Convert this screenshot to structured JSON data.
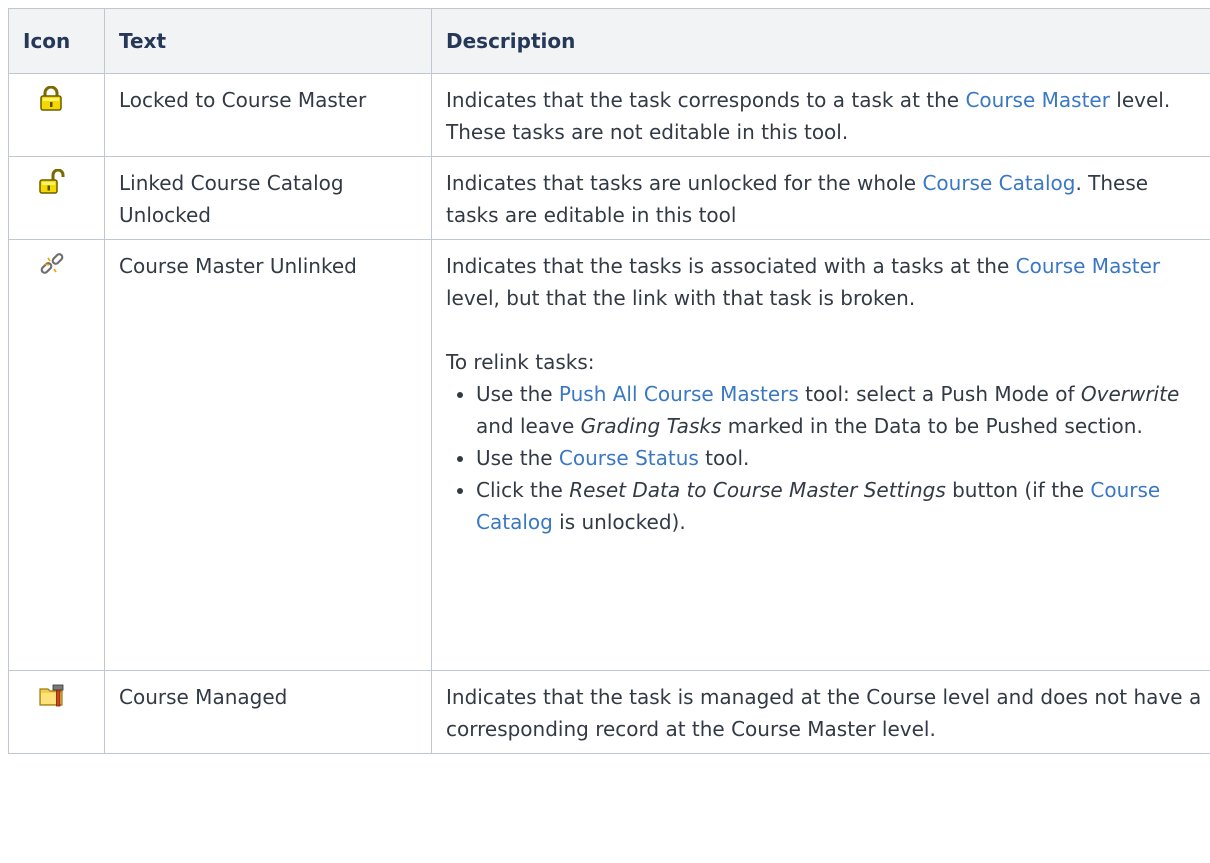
{
  "table": {
    "headers": {
      "icon": "Icon",
      "text": "Text",
      "description": "Description"
    },
    "rows": [
      {
        "icon": "padlock-locked-icon",
        "text": "Locked to Course Master",
        "desc": {
          "p1a": "Indicates that the task corresponds to a task at the ",
          "link1": "Course Master",
          "p1b": " level. These tasks are not editable in this tool."
        }
      },
      {
        "icon": "padlock-unlocked-icon",
        "text": "Linked Course Catalog Unlocked",
        "desc": {
          "p1a": "Indicates that tasks are unlocked for the whole ",
          "link1": "Course Catalog",
          "p1b": ". These tasks are editable in this tool"
        }
      },
      {
        "icon": "broken-link-icon",
        "text": "Course Master Unlinked",
        "desc": {
          "p1a": "Indicates that the tasks is associated with a tasks at the ",
          "link1": "Course Master",
          "p1b": " level, but that the link with that task is broken.",
          "p2": "To relink tasks:",
          "b1a": "Use the ",
          "b1link": "Push All Course Masters",
          "b1b": " tool: select a Push Mode of ",
          "b1em1": "Overwrite",
          "b1c": " and leave ",
          "b1em2": "Grading Tasks",
          "b1d": " marked in the Data to be Pushed section.",
          "b2a": "Use the ",
          "b2link": "Course Status",
          "b2b": " tool.",
          "b3a": "Click the ",
          "b3em": "Reset Data to Course Master Settings",
          "b3b": " button (if the ",
          "b3link": "Course Catalog",
          "b3c": " is unlocked)."
        }
      },
      {
        "icon": "course-managed-icon",
        "text": "Course Managed",
        "desc": {
          "p1": "Indicates that the task is managed at the Course level and does not have a corresponding record at the Course Master level."
        }
      }
    ]
  },
  "colors": {
    "link": "#3a78c3",
    "header_bg": "#f2f3f5",
    "border": "#c1c7d0",
    "text": "#333a45"
  }
}
